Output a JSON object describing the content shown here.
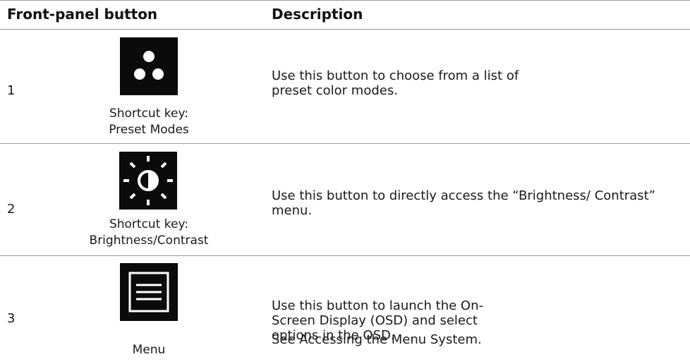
{
  "table": {
    "headers": {
      "button": "Front-panel button",
      "description": "Description"
    },
    "rows": [
      {
        "number": "1",
        "icon": "preset-modes-icon",
        "caption_line1": "Shortcut key:",
        "caption_line2": "Preset Modes",
        "description": "Use this button to choose from a list of preset color modes."
      },
      {
        "number": "2",
        "icon": "brightness-contrast-icon",
        "caption_line1": "Shortcut key:",
        "caption_line2": "Brightness/Contrast",
        "description": "Use this button to directly access the “Brightness/ Contrast” menu."
      },
      {
        "number": "3",
        "icon": "menu-icon",
        "caption": "Menu",
        "description": "Use this button to launch the On-Screen Display (OSD) and select options in the OSD.",
        "note": "See Accessing the Menu System."
      }
    ]
  },
  "colors": {
    "icon_background": "#0b0b0b",
    "icon_foreground": "#ffffff",
    "rule": "#9a9a9a"
  }
}
